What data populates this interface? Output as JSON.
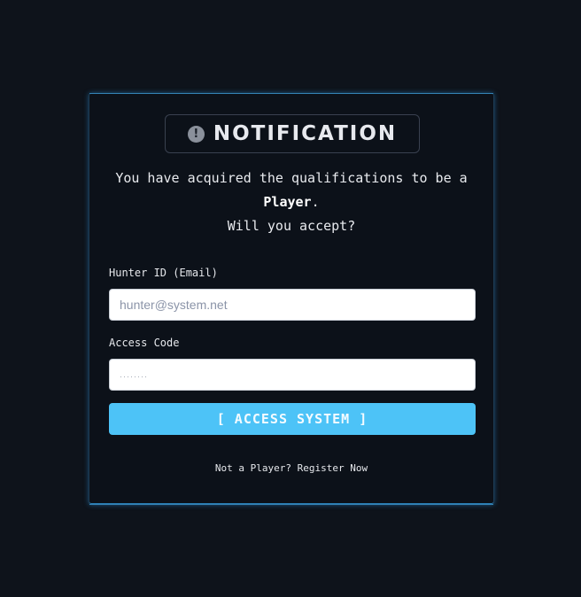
{
  "colors": {
    "background": "#0e131b",
    "panel": "#0c1119",
    "accent_glow": "#3a96d0",
    "button": "#4dc3f7"
  },
  "notification": {
    "icon": "exclamation-circle-icon",
    "icon_glyph": "!",
    "title": "NOTIFICATION"
  },
  "message": {
    "line1": "You have acquired the qualifications to be a",
    "highlight": "Player",
    "period": ".",
    "line3": "Will you accept?"
  },
  "form": {
    "email_label": "Hunter ID (Email)",
    "email_placeholder": "hunter@system.net",
    "email_value": "",
    "password_label": "Access Code",
    "password_placeholder": "········",
    "password_value": "",
    "submit_label": "[ ACCESS SYSTEM ]"
  },
  "footer": {
    "prompt": "Not a Player?",
    "register_link": "Register Now"
  }
}
